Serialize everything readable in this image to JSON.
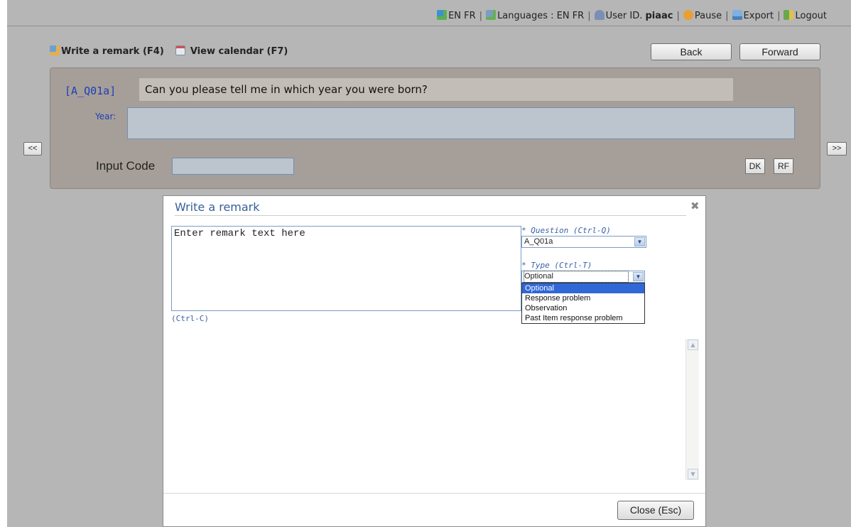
{
  "topbar": {
    "lang_current": "EN FR",
    "languages": "Languages : EN FR",
    "user_prefix": "User ID.",
    "user_id": "piaac",
    "pause": "Pause",
    "export": "Export",
    "logout": "Logout"
  },
  "toolbar": {
    "write_remark": "Write a remark (F4)",
    "view_calendar": "View calendar (F7)",
    "back": "Back",
    "forward": "Forward"
  },
  "question": {
    "id": "[A_Q01a]",
    "text": "Can you please tell me in which year you were born?",
    "year_label": "Year:",
    "input_code_label": "Input Code",
    "dk": "DK",
    "rf": "RF",
    "prev": "<<",
    "next": ">>"
  },
  "dialog": {
    "title": "Write a remark",
    "close_icon": "✖",
    "remark_placeholder": "Enter remark text here",
    "ctrl_c": "(Ctrl-C)",
    "question_label": "* Question (Ctrl-Q)",
    "question_value": "A_Q01a",
    "type_label": "* Type (Ctrl-T)",
    "type_value": "Optional",
    "type_options": [
      "Optional",
      "Response problem",
      "Observation",
      "Past Item response problem"
    ],
    "close_button": "Close (Esc)"
  }
}
